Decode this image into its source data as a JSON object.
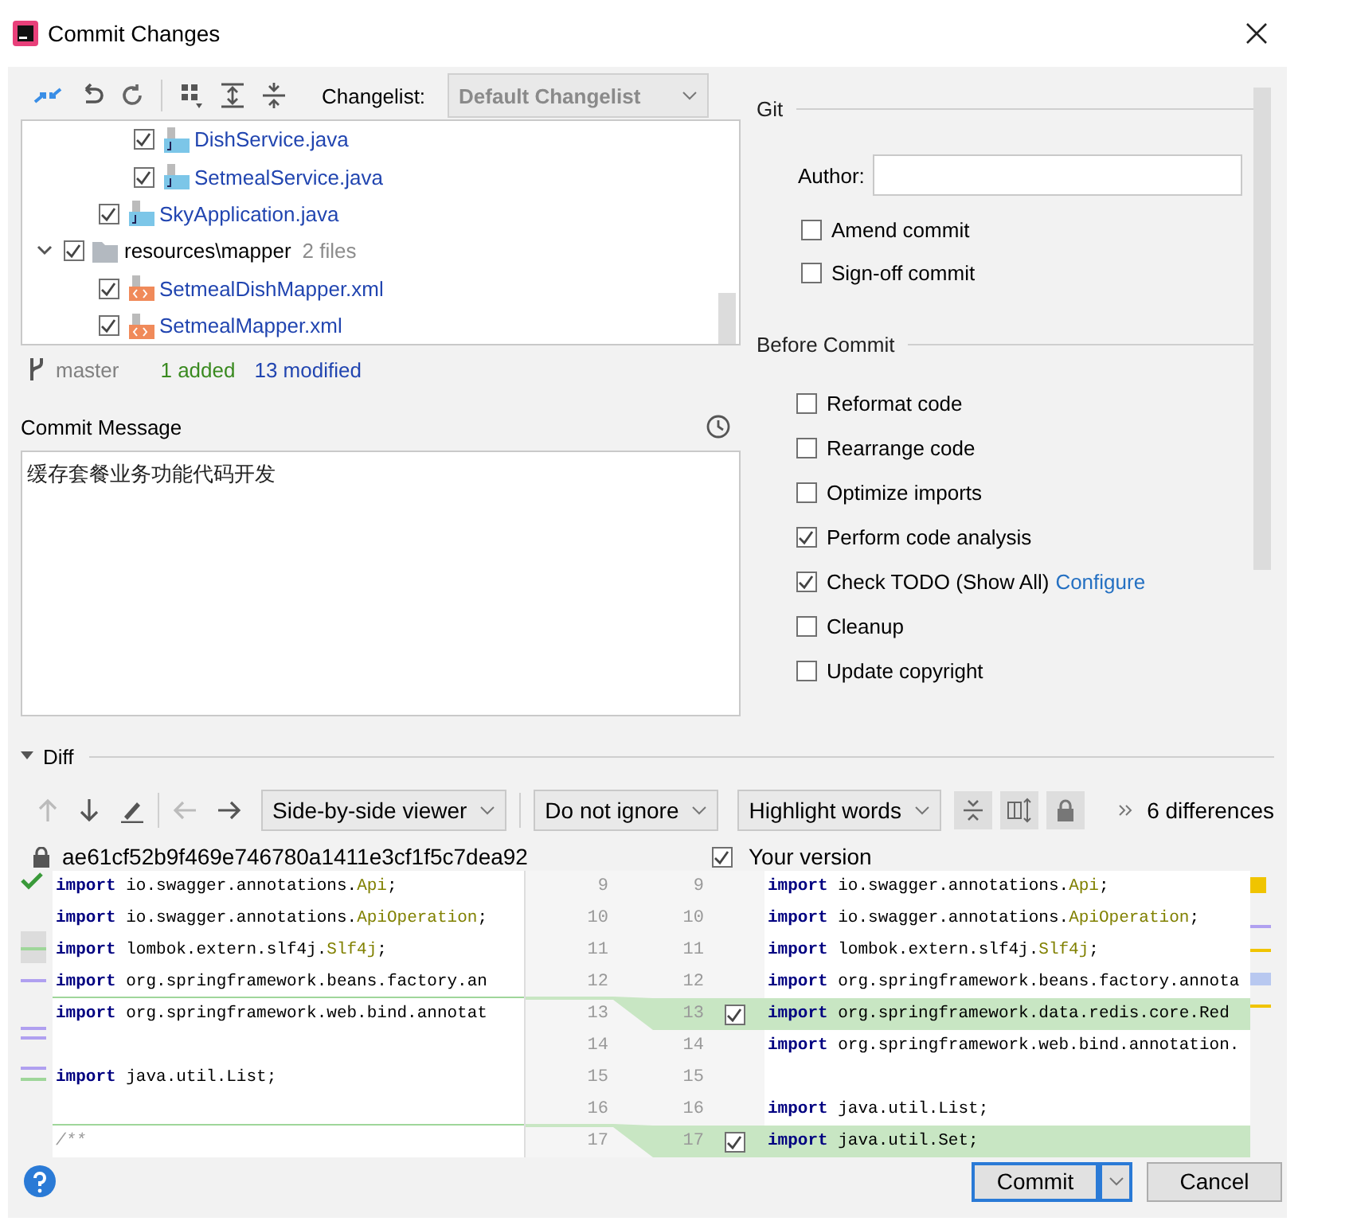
{
  "window": {
    "title": "Commit Changes"
  },
  "changes": {
    "changelist_label": "Changelist:",
    "changelist": "Default Changelist",
    "tree": [
      {
        "children": [
          {
            "children": [
              {
                "kind": "java",
                "label": "DishService.java",
                "checked": true
              },
              {
                "kind": "java",
                "label": "SetmealService.java",
                "checked": true
              }
            ]
          },
          {
            "kind": "java",
            "label": "SkyApplication.java",
            "checked": true
          }
        ]
      },
      {
        "kind": "folder",
        "label": "resources\\mapper",
        "count": "2 files",
        "checked": true,
        "expanded": true,
        "children": [
          {
            "kind": "xml",
            "label": "SetmealDishMapper.xml",
            "checked": true
          },
          {
            "kind": "xml",
            "label": "SetmealMapper.xml",
            "checked": true
          }
        ]
      }
    ],
    "branch": "master",
    "added": "1 added",
    "modified": "13 modified"
  },
  "commit_message": {
    "label": "Commit Message",
    "value": "缓存套餐业务功能代码开发"
  },
  "git": {
    "title": "Git",
    "author_label": "Author:",
    "options": [
      {
        "label": "Amend commit",
        "checked": false
      },
      {
        "label": "Sign-off commit",
        "checked": false
      }
    ]
  },
  "before_commit": {
    "title": "Before Commit",
    "options": [
      {
        "label": "Reformat code",
        "checked": false
      },
      {
        "label": "Rearrange code",
        "checked": false
      },
      {
        "label": "Optimize imports",
        "checked": false
      },
      {
        "label": "Perform code analysis",
        "checked": true
      },
      {
        "label": "Check TODO (Show All)",
        "checked": true,
        "link": "Configure"
      },
      {
        "label": "Cleanup",
        "checked": false
      },
      {
        "label": "Update copyright",
        "checked": false
      }
    ]
  },
  "diff": {
    "title": "Diff",
    "expanded": true,
    "viewer": "Side-by-side viewer",
    "ignore": "Do not ignore",
    "highlight": "Highlight words",
    "differences": "6 differences",
    "left_title": "ae61cf52b9f469e746780a1411e3cf1f5c7dea92",
    "right_title": "Your version",
    "right_checked": true,
    "rows": [
      {
        "left_no": "9",
        "left": {
          "keyword": "import",
          "path": "io.swagger.annotations.",
          "type_name": "Api",
          "tail": ";"
        },
        "right_no": "9",
        "right": {
          "keyword": "import",
          "path": "io.swagger.annotations.",
          "type_name": "Api",
          "tail": ";"
        },
        "added": false
      },
      {
        "left_no": "10",
        "left": {
          "keyword": "import",
          "path": "io.swagger.annotations.",
          "type_name": "ApiOperation",
          "tail": ";"
        },
        "right_no": "10",
        "right": {
          "keyword": "import",
          "path": "io.swagger.annotations.",
          "type_name": "ApiOperation",
          "tail": ";"
        },
        "added": false
      },
      {
        "left_no": "11",
        "left": {
          "keyword": "import",
          "path": "lombok.extern.slf4j.",
          "type_name": "Slf4j",
          "tail": ";"
        },
        "right_no": "11",
        "right": {
          "keyword": "import",
          "path": "lombok.extern.slf4j.",
          "type_name": "Slf4j",
          "tail": ";"
        },
        "added": false
      },
      {
        "left_no": "12",
        "left": {
          "keyword": "import",
          "path": "org.springframework.beans.factory.an"
        },
        "right_no": "12",
        "right": {
          "keyword": "import",
          "path": "org.springframework.beans.factory.annota"
        },
        "added": false
      },
      {
        "left_no": "13",
        "left": {
          "keyword": "import",
          "path": "org.springframework.web.bind.annotat"
        },
        "right_no": "13",
        "right": {
          "keyword": "import",
          "path": "org.springframework.data.redis.core.Red"
        },
        "added": true,
        "checked": true
      },
      {
        "left_no": "14",
        "right_no": "14",
        "right": {
          "keyword": "import",
          "path": "org.springframework.web.bind.annotation."
        },
        "added": false
      },
      {
        "left_no": "15",
        "left": {
          "keyword": "import",
          "path": "java.util.List;"
        },
        "right_no": "15",
        "added": false
      },
      {
        "left_no": "16",
        "right_no": "16",
        "right": {
          "keyword": "import",
          "path": "java.util.List;"
        },
        "added": false
      },
      {
        "left_no": "17",
        "left": {
          "comment": "/**"
        },
        "right_no": "17",
        "right": {
          "keyword": "import",
          "path": "java.util.Set;"
        },
        "added": true,
        "checked": true
      }
    ]
  },
  "buttons": [
    {
      "label": "Commit",
      "kind": "split",
      "default": true
    },
    {
      "label": "Cancel",
      "kind": "plain",
      "default": false
    }
  ]
}
